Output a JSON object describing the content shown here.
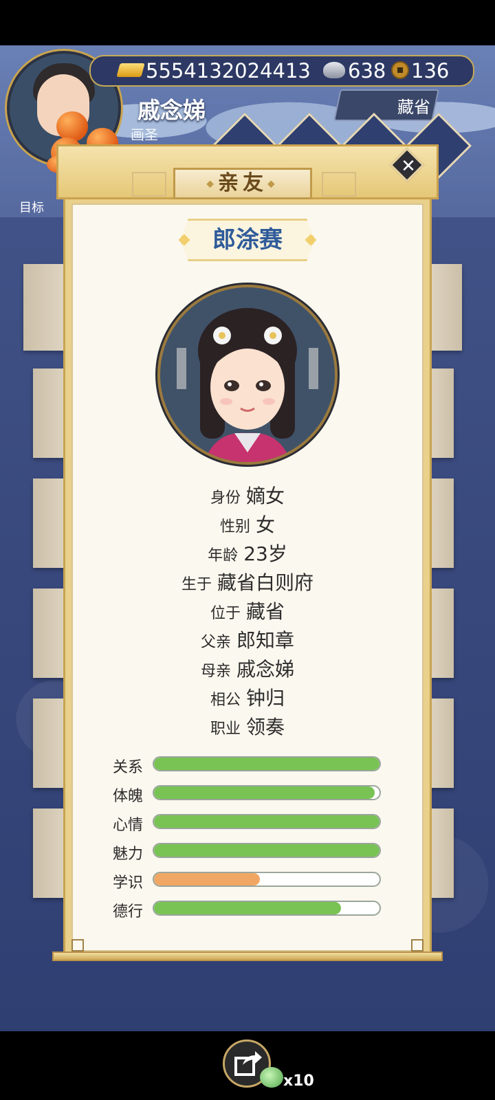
{
  "hud": {
    "player_name": "戚念娣",
    "player_title": "画圣",
    "gold": "5554132024413",
    "silver": "638",
    "coins": "136",
    "location": "藏省",
    "target_label": "目标"
  },
  "modal": {
    "title": "亲友",
    "close_symbol": "✕",
    "character_name": "郎涂赛",
    "info": [
      {
        "label": "身份",
        "value": "嫡女"
      },
      {
        "label": "性别",
        "value": "女"
      },
      {
        "label": "年龄",
        "value": "23岁"
      },
      {
        "label": "生于",
        "value": "藏省白则府"
      },
      {
        "label": "位于",
        "value": "藏省"
      },
      {
        "label": "父亲",
        "value": "郎知章"
      },
      {
        "label": "母亲",
        "value": "戚念娣"
      },
      {
        "label": "相公",
        "value": "钟归"
      },
      {
        "label": "职业",
        "value": "领奏"
      }
    ],
    "stats": [
      {
        "label": "关系",
        "level": 1.0,
        "color": "#78c353"
      },
      {
        "label": "体魄",
        "level": 0.98,
        "color": "#78c353"
      },
      {
        "label": "心情",
        "level": 1.0,
        "color": "#78c353"
      },
      {
        "label": "魅力",
        "level": 1.0,
        "color": "#78c353"
      },
      {
        "label": "学识",
        "level": 0.47,
        "color": "#f0a764"
      },
      {
        "label": "德行",
        "level": 0.83,
        "color": "#78c353"
      }
    ]
  },
  "bottom": {
    "share_count": "x10",
    "share_icon": "share-icon",
    "pet_icon": "pet-icon"
  }
}
